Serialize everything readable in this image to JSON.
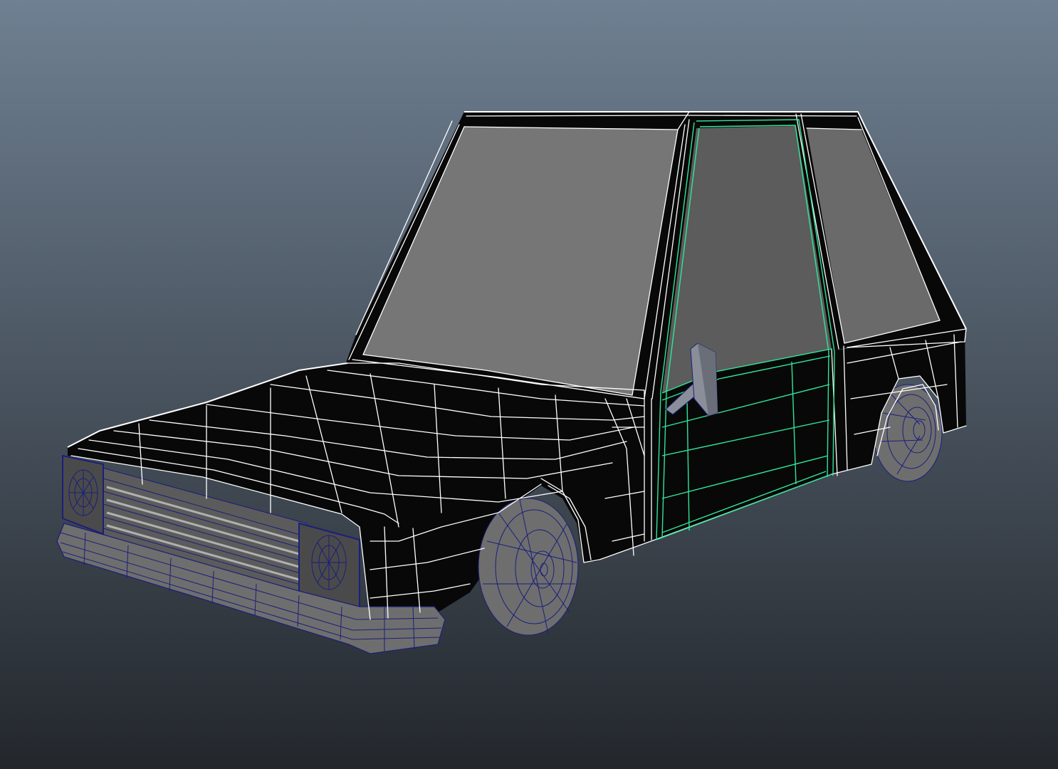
{
  "viewport": {
    "name": "3d-viewport",
    "background_top": "#6f8092",
    "background_bottom": "#23272c"
  },
  "scene": {
    "object": "car-model",
    "display_mode": "wireframe-on-shaded",
    "colors": {
      "body": "#080808",
      "glass_front": "#767676",
      "glass_side": "#5c5c5c",
      "rubber": "#6e6e6e",
      "wire": "#ffffff",
      "wire_low": "#1b1f7a",
      "selection": "#2fe59a",
      "mirror": "#8a8e98"
    }
  }
}
